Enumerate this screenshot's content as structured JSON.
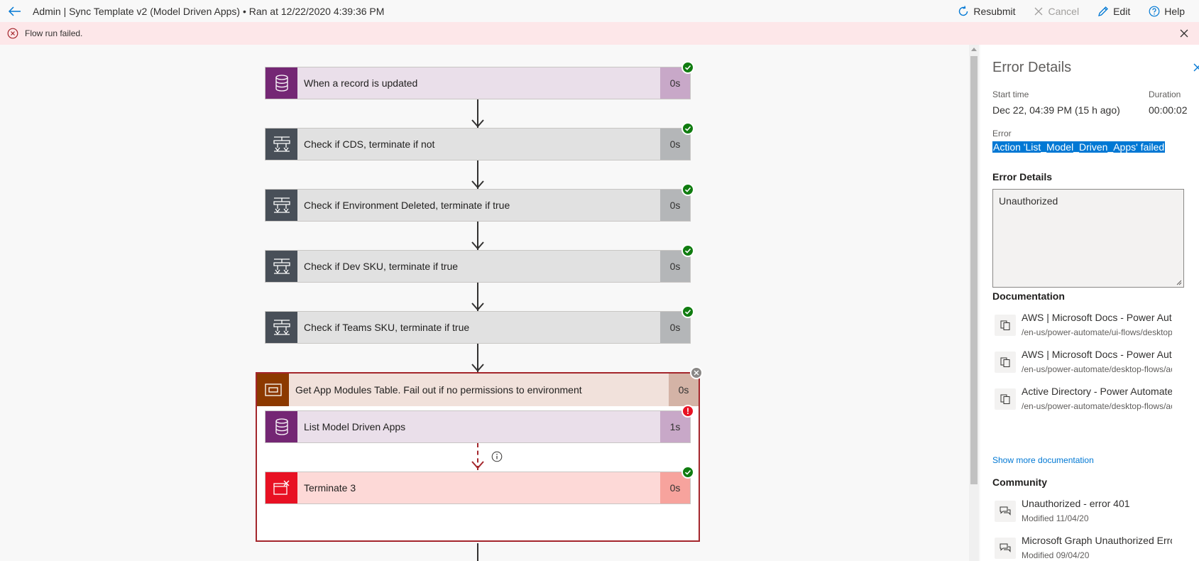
{
  "header": {
    "title": "Admin | Sync Template v2 (Model Driven Apps) • Ran at 12/22/2020 4:39:36 PM",
    "actions": {
      "resubmit": "Resubmit",
      "cancel": "Cancel",
      "edit": "Edit",
      "help": "Help"
    }
  },
  "banner": {
    "message": "Flow run failed."
  },
  "steps": [
    {
      "title": "When a record is updated",
      "duration": "0s",
      "status": "succeeded",
      "icon": "database-icon"
    },
    {
      "title": "Check if CDS, terminate if not",
      "duration": "0s",
      "status": "succeeded",
      "icon": "condition-icon"
    },
    {
      "title": "Check if Environment Deleted, terminate if true",
      "duration": "0s",
      "status": "succeeded",
      "icon": "condition-icon"
    },
    {
      "title": "Check if Dev SKU, terminate if true",
      "duration": "0s",
      "status": "succeeded",
      "icon": "condition-icon"
    },
    {
      "title": "Check if Teams SKU, terminate if true",
      "duration": "0s",
      "status": "succeeded",
      "icon": "condition-icon"
    }
  ],
  "scope": {
    "title": "Get App Modules Table. Fail out if no permissions to environment",
    "duration": "0s",
    "status": "skipped",
    "icon": "scope-icon",
    "children": [
      {
        "title": "List Model Driven Apps",
        "duration": "1s",
        "status": "failed",
        "icon": "database-icon"
      },
      {
        "title": "Terminate 3",
        "duration": "0s",
        "status": "succeeded",
        "icon": "terminate-icon"
      }
    ]
  },
  "colors": {
    "dataverse": "#742774",
    "dataverse_light": "#eadfea",
    "control": "#484f58",
    "control_light": "#e1e1e1",
    "scope": "#8c3900",
    "scope_light": "#f1e1db",
    "terminate": "#e81123",
    "terminate_light": "#fdd9d7",
    "accent": "#0078d4"
  },
  "panel": {
    "title": "Error Details",
    "start_time_label": "Start time",
    "start_time": "Dec 22, 04:39 PM (15 h ago)",
    "duration_label": "Duration",
    "duration": "00:00:02",
    "error_label": "Error",
    "error": "Action 'List_Model_Driven_Apps' failed",
    "details_label": "Error Details",
    "details": "Unauthorized",
    "documentation_label": "Documentation",
    "documentation": [
      {
        "title": "AWS | Microsoft Docs - Power Automate",
        "path": "/en-us/power-automate/ui-flows/desktop/"
      },
      {
        "title": "AWS | Microsoft Docs - Power Automate",
        "path": "/en-us/power-automate/desktop-flows/act"
      },
      {
        "title": "Active Directory - Power Automate",
        "path": "/en-us/power-automate/desktop-flows/act"
      }
    ],
    "show_more": "Show more documentation",
    "community_label": "Community",
    "community": [
      {
        "title": "Unauthorized - error 401",
        "modified": "Modified 11/04/20"
      },
      {
        "title": "Microsoft Graph Unauthorized Error",
        "modified": "Modified 09/04/20"
      }
    ]
  }
}
